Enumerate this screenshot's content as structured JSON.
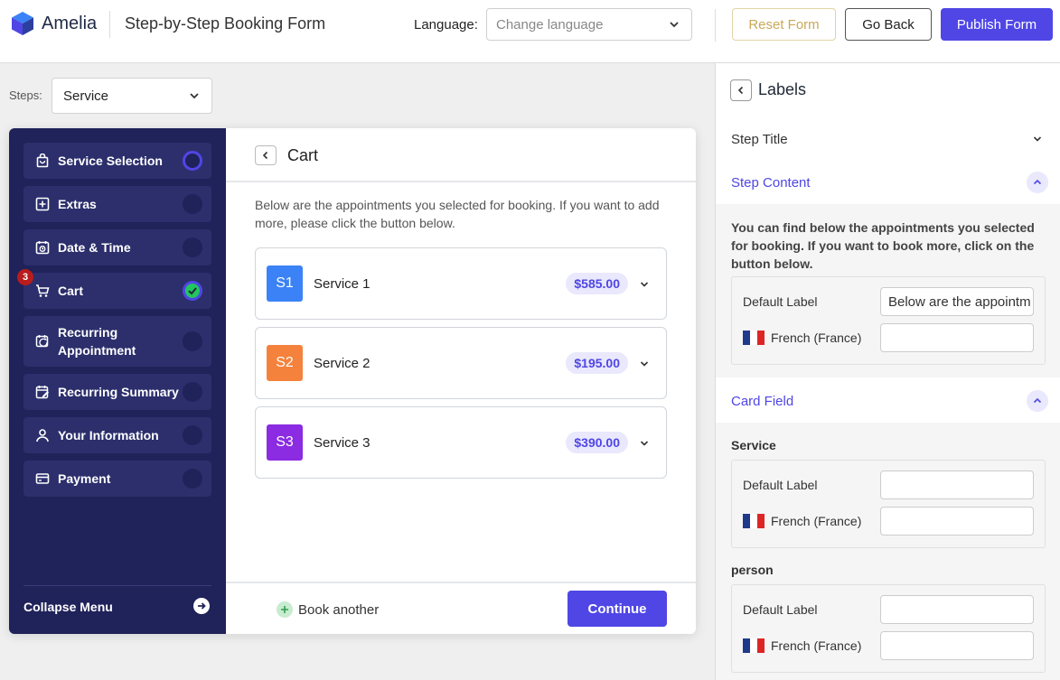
{
  "header": {
    "brand": "Amelia",
    "title": "Step-by-Step Booking Form",
    "language_label": "Language:",
    "language_placeholder": "Change language",
    "reset_label": "Reset Form",
    "back_label": "Go Back",
    "publish_label": "Publish Form"
  },
  "steps_selector": {
    "label": "Steps:",
    "value": "Service"
  },
  "sidebar": {
    "items": [
      {
        "label": "Service Selection",
        "icon": "bag-icon",
        "state": "active"
      },
      {
        "label": "Extras",
        "icon": "plus-square-icon",
        "state": "pending"
      },
      {
        "label": "Date & Time",
        "icon": "calendar-clock-icon",
        "state": "pending"
      },
      {
        "label": "Cart",
        "icon": "cart-icon",
        "state": "done",
        "badge": "3"
      },
      {
        "label": "Recurring Appointment",
        "icon": "recurring-icon",
        "state": "pending"
      },
      {
        "label": "Recurring Summary",
        "icon": "calendar-edit-icon",
        "state": "pending"
      },
      {
        "label": "Your Information",
        "icon": "user-icon",
        "state": "pending"
      },
      {
        "label": "Payment",
        "icon": "card-icon",
        "state": "pending"
      }
    ],
    "collapse_label": "Collapse Menu"
  },
  "cart": {
    "title": "Cart",
    "intro": "Below are the appointments you selected for booking. If you want to add more, please click the button below.",
    "services": [
      {
        "code": "S1",
        "name": "Service 1",
        "price": "$585.00",
        "color": "#3b82f6"
      },
      {
        "code": "S2",
        "name": "Service 2",
        "price": "$195.00",
        "color": "#f5823c"
      },
      {
        "code": "S3",
        "name": "Service 3",
        "price": "$390.00",
        "color": "#8b2be2"
      }
    ],
    "book_another_label": "Book another",
    "continue_label": "Continue"
  },
  "panel": {
    "title": "Labels",
    "step_title": "Step Title",
    "step_content": {
      "title": "Step Content",
      "description": "You can find below the appointments you selected for booking. If you want to book more, click on the button below.",
      "default_label": "Default Label",
      "default_value": "Below are the appointm",
      "french_label": "French (France)",
      "french_value": ""
    },
    "card_field": {
      "title": "Card Field",
      "fields": [
        {
          "name": "Service",
          "default_label": "Default Label",
          "default_value": "",
          "french_label": "French (France)",
          "french_value": ""
        },
        {
          "name": "person",
          "default_label": "Default Label",
          "default_value": "",
          "french_label": "French (France)",
          "french_value": ""
        }
      ]
    }
  },
  "colors": {
    "accent": "#4f46e5",
    "sidebar_bg": "#20225a",
    "sidebar_item_bg": "#2c2f6c",
    "success": "#22c55e",
    "badge": "#b91c1c"
  }
}
